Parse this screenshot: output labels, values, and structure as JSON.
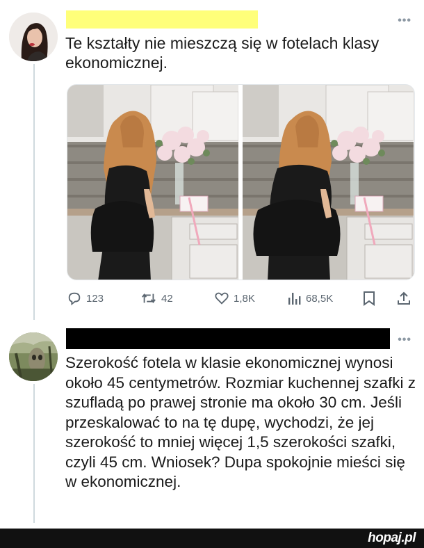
{
  "colors": {
    "thread_line": "#cfd9de",
    "redaction_yellow": "#ffff7a",
    "redaction_black": "#000000",
    "text": "#1a1a1a",
    "muted": "#5b6670",
    "footer_bg": "#111111"
  },
  "post": {
    "text": "Te kształty nie mieszczą się w fotelach klasy ekonomicznej.",
    "more_label": "•••",
    "stats": {
      "replies": "123",
      "reposts": "42",
      "likes": "1,8K",
      "views": "68,5K"
    },
    "icons": [
      "reply-icon",
      "repost-icon",
      "like-icon",
      "views-icon",
      "bookmark-icon",
      "share-icon"
    ]
  },
  "reply": {
    "text": "Szerokość fotela w klasie ekonomicznej wynosi około 45 centymetrów. Rozmiar kuchennej szafki z szufladą po prawej stronie ma około 30 cm. Jeśli przeskalować to na tę dupę, wychodzi, że jej szerokość to mniej więcej 1,5 szerokości szafki, czyli 45 cm. Wniosek? Dupa spokojnie mieści się w ekonomicznej.",
    "more_label": "•••"
  },
  "footer": {
    "brand": "hopaj.pl"
  }
}
